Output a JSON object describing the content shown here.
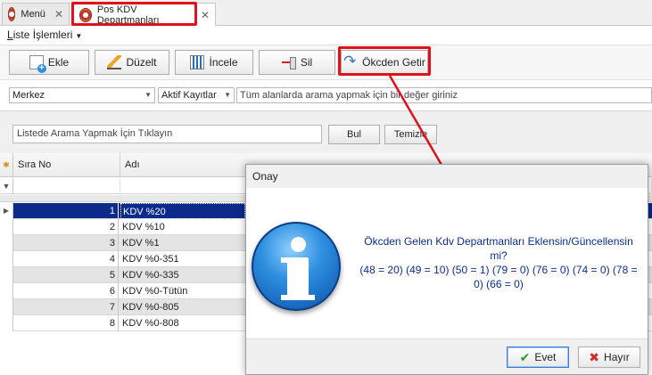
{
  "tabs": [
    {
      "label": "Menü",
      "active": false
    },
    {
      "label": "Pos KDV Departmanları",
      "active": true
    }
  ],
  "menu": {
    "list_ops_prefix": "L",
    "list_ops_rest": "iste İşlemleri"
  },
  "toolbar": {
    "add": "Ekle",
    "edit": "Düzelt",
    "view": "İncele",
    "delete": "Sil",
    "fetch": "Ökcden Getir"
  },
  "filters": {
    "branch": "Merkez",
    "record_filter": "Aktif Kayıtlar",
    "search_all_placeholder": "Tüm alanlarda arama yapmak için bir değer giriniz"
  },
  "search_panel": {
    "placeholder": "Listede Arama Yapmak İçin Tıklayın",
    "find": "Bul",
    "clear": "Temizle"
  },
  "grid": {
    "columns": [
      "Sıra No",
      "Adı"
    ],
    "rows": [
      {
        "no": "1",
        "name": "KDV %20"
      },
      {
        "no": "2",
        "name": "KDV %10"
      },
      {
        "no": "3",
        "name": "KDV %1"
      },
      {
        "no": "4",
        "name": "KDV %0-351"
      },
      {
        "no": "5",
        "name": "KDV %0-335"
      },
      {
        "no": "6",
        "name": "KDV %0-Tütün"
      },
      {
        "no": "7",
        "name": "KDV %0-805"
      },
      {
        "no": "8",
        "name": "KDV %0-808"
      }
    ],
    "selected_row": 0
  },
  "dialog": {
    "title": "Onay",
    "message_line1": "Ökcden Gelen Kdv Departmanları Eklensin/Güncellensin mi?",
    "message_line2": "(48 = 20) (49 = 10) (50 = 1) (79 = 0) (76 = 0) (74 = 0) (78 = 0) (66 = 0)",
    "yes": "Evet",
    "no": "Hayır",
    "icon": "info-icon"
  },
  "colors": {
    "highlight": "#e2101a",
    "selection": "#0b2a8a",
    "message_text": "#0b2e8a"
  }
}
